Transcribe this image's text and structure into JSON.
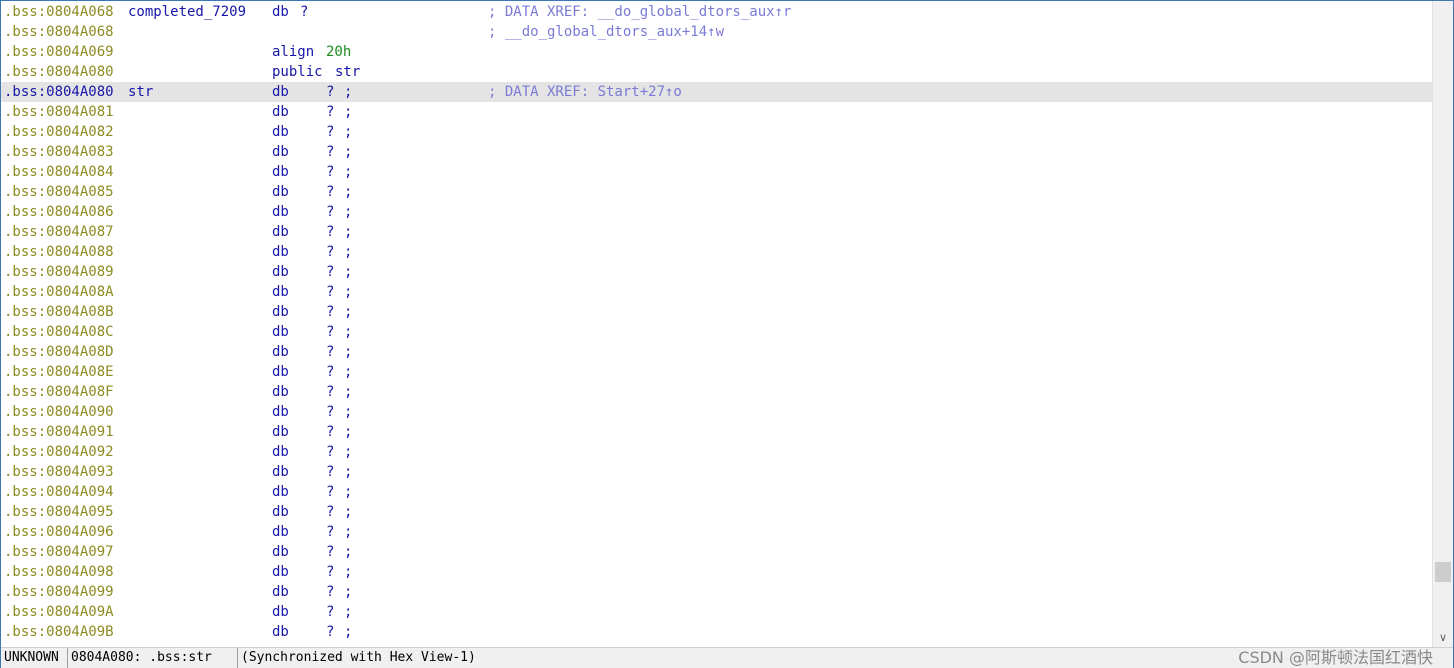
{
  "listing": {
    "rows": [
      {
        "addr": ".bss:0804A068",
        "label": "completed_7209",
        "mnem": "db",
        "op": "?",
        "comment": "; DATA XREF: __do_global_dtors_aux↑r"
      },
      {
        "addr": ".bss:0804A068",
        "label": "",
        "mnem": "",
        "op": "",
        "comment": "; __do_global_dtors_aux+14↑w"
      },
      {
        "addr": ".bss:0804A069",
        "label": "",
        "mnem": "align",
        "op": "20h",
        "comment": ""
      },
      {
        "addr": ".bss:0804A080",
        "label": "",
        "mnem": "public",
        "op": "str",
        "comment": ""
      },
      {
        "addr": ".bss:0804A080",
        "label": "str",
        "mnem": "db",
        "op": "?",
        "semi": ";",
        "comment": "; DATA XREF: Start+27↑o",
        "selected": true
      },
      {
        "addr": ".bss:0804A081",
        "mnem": "db",
        "op": "?",
        "semi": ";"
      },
      {
        "addr": ".bss:0804A082",
        "mnem": "db",
        "op": "?",
        "semi": ";"
      },
      {
        "addr": ".bss:0804A083",
        "mnem": "db",
        "op": "?",
        "semi": ";"
      },
      {
        "addr": ".bss:0804A084",
        "mnem": "db",
        "op": "?",
        "semi": ";"
      },
      {
        "addr": ".bss:0804A085",
        "mnem": "db",
        "op": "?",
        "semi": ";"
      },
      {
        "addr": ".bss:0804A086",
        "mnem": "db",
        "op": "?",
        "semi": ";"
      },
      {
        "addr": ".bss:0804A087",
        "mnem": "db",
        "op": "?",
        "semi": ";"
      },
      {
        "addr": ".bss:0804A088",
        "mnem": "db",
        "op": "?",
        "semi": ";"
      },
      {
        "addr": ".bss:0804A089",
        "mnem": "db",
        "op": "?",
        "semi": ";"
      },
      {
        "addr": ".bss:0804A08A",
        "mnem": "db",
        "op": "?",
        "semi": ";"
      },
      {
        "addr": ".bss:0804A08B",
        "mnem": "db",
        "op": "?",
        "semi": ";"
      },
      {
        "addr": ".bss:0804A08C",
        "mnem": "db",
        "op": "?",
        "semi": ";"
      },
      {
        "addr": ".bss:0804A08D",
        "mnem": "db",
        "op": "?",
        "semi": ";"
      },
      {
        "addr": ".bss:0804A08E",
        "mnem": "db",
        "op": "?",
        "semi": ";"
      },
      {
        "addr": ".bss:0804A08F",
        "mnem": "db",
        "op": "?",
        "semi": ";"
      },
      {
        "addr": ".bss:0804A090",
        "mnem": "db",
        "op": "?",
        "semi": ";"
      },
      {
        "addr": ".bss:0804A091",
        "mnem": "db",
        "op": "?",
        "semi": ";"
      },
      {
        "addr": ".bss:0804A092",
        "mnem": "db",
        "op": "?",
        "semi": ";"
      },
      {
        "addr": ".bss:0804A093",
        "mnem": "db",
        "op": "?",
        "semi": ";"
      },
      {
        "addr": ".bss:0804A094",
        "mnem": "db",
        "op": "?",
        "semi": ";"
      },
      {
        "addr": ".bss:0804A095",
        "mnem": "db",
        "op": "?",
        "semi": ";"
      },
      {
        "addr": ".bss:0804A096",
        "mnem": "db",
        "op": "?",
        "semi": ";"
      },
      {
        "addr": ".bss:0804A097",
        "mnem": "db",
        "op": "?",
        "semi": ";"
      },
      {
        "addr": ".bss:0804A098",
        "mnem": "db",
        "op": "?",
        "semi": ";"
      },
      {
        "addr": ".bss:0804A099",
        "mnem": "db",
        "op": "?",
        "semi": ";"
      },
      {
        "addr": ".bss:0804A09A",
        "mnem": "db",
        "op": "?",
        "semi": ";"
      },
      {
        "addr": ".bss:0804A09B",
        "mnem": "db",
        "op": "?",
        "semi": ";"
      }
    ]
  },
  "status": {
    "mode": "UNKNOWN",
    "location": "0804A080: .bss:str",
    "sync": "(Synchronized with Hex View-1)"
  },
  "scrollbar": {
    "arrow_icon": "chevron-down-icon"
  },
  "watermark": "CSDN @阿斯顿法国红酒快"
}
